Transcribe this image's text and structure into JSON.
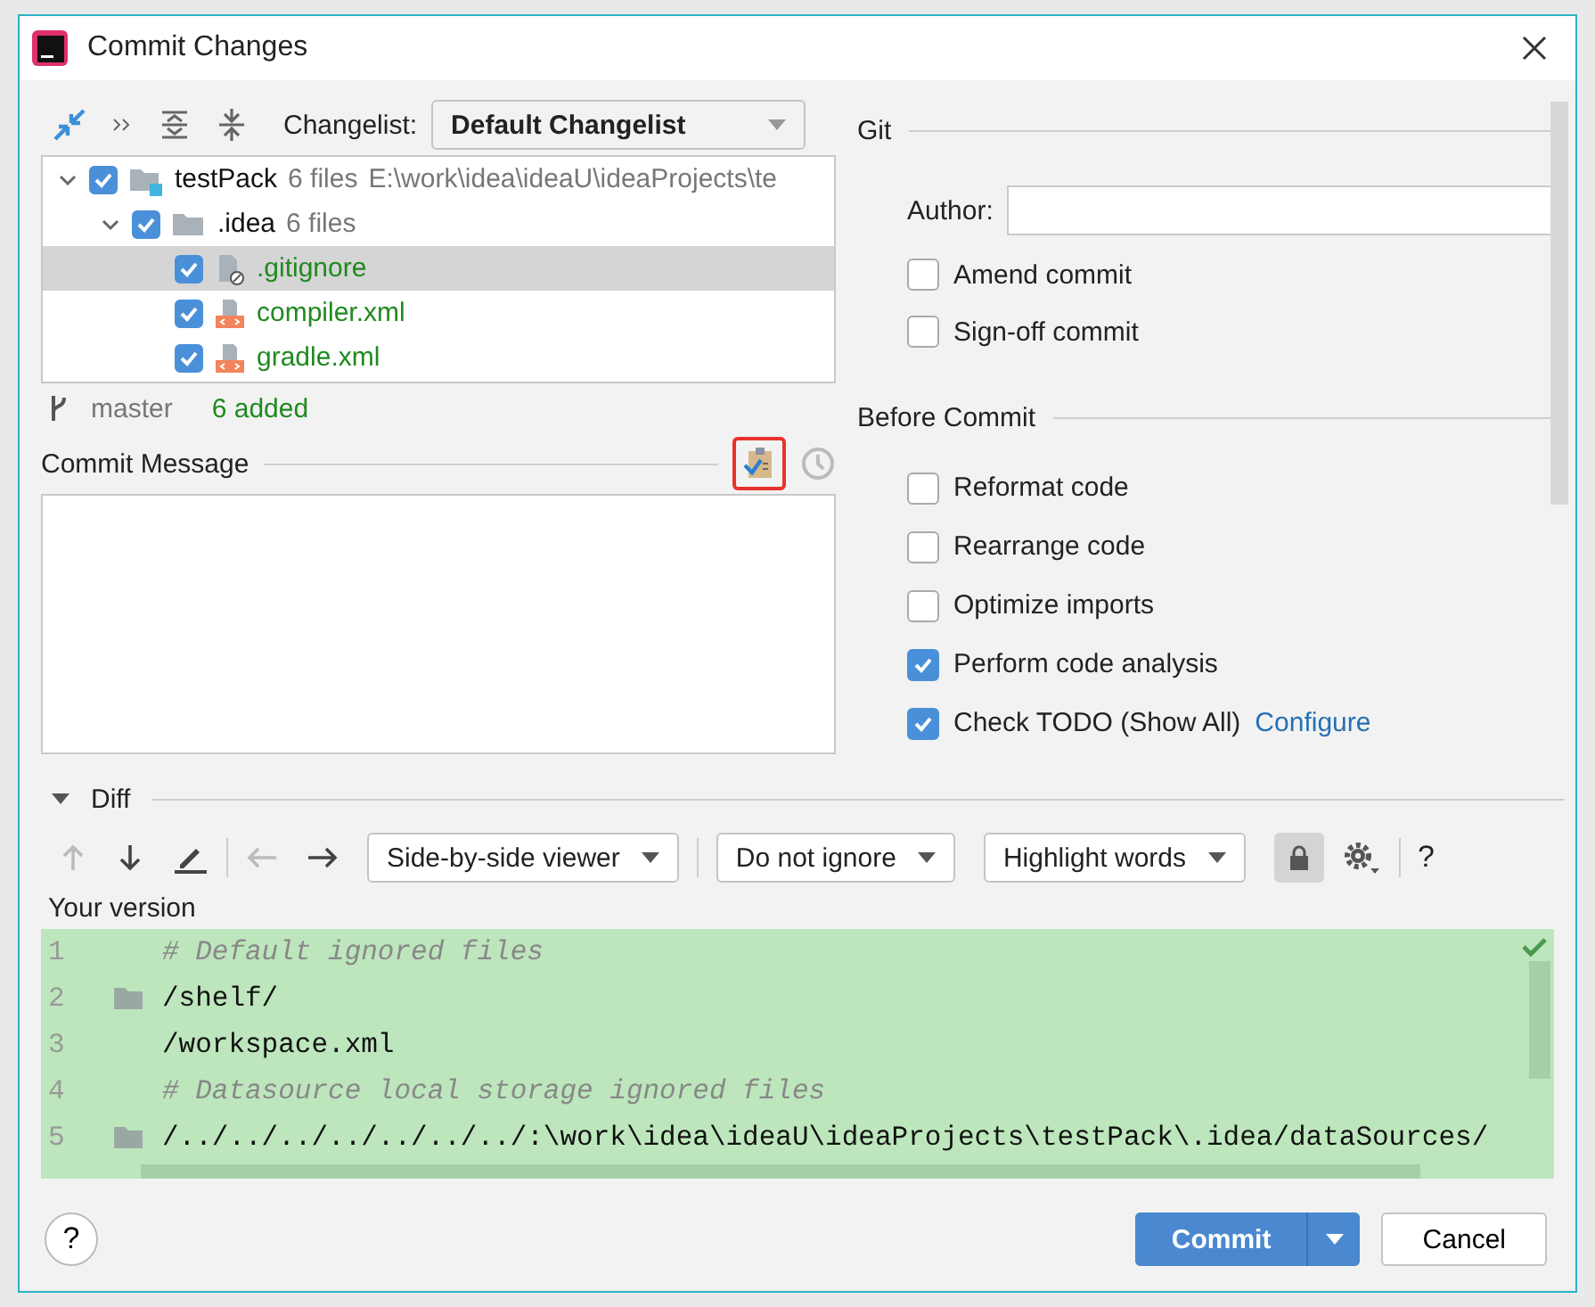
{
  "window": {
    "title": "Commit Changes"
  },
  "toolbar": {
    "changelist_label": "Changelist:",
    "changelist_value": "Default Changelist"
  },
  "tree": [
    {
      "name": "testPack",
      "count": "6 files",
      "path": "E:\\work\\idea\\ideaU\\ideaProjects\\te",
      "checked": true,
      "expanded": true,
      "selected": false,
      "kind": "module",
      "children": [
        {
          "name": ".idea",
          "count": "6 files",
          "checked": true,
          "expanded": true,
          "selected": false,
          "kind": "folder",
          "children": [
            {
              "name": ".gitignore",
              "checked": true,
              "selected": true,
              "kind": "ignore"
            },
            {
              "name": "compiler.xml",
              "checked": true,
              "selected": false,
              "kind": "xml"
            },
            {
              "name": "gradle.xml",
              "checked": true,
              "selected": false,
              "kind": "xml"
            }
          ]
        }
      ]
    }
  ],
  "status": {
    "branch": "master",
    "summary": "6 added"
  },
  "commit_message": {
    "label": "Commit Message"
  },
  "git": {
    "title": "Git",
    "author_label": "Author:",
    "options": [
      {
        "label": "Amend commit",
        "checked": false
      },
      {
        "label": "Sign-off commit",
        "checked": false
      }
    ]
  },
  "before_commit": {
    "title": "Before Commit",
    "options": [
      {
        "label": "Reformat code",
        "checked": false
      },
      {
        "label": "Rearrange code",
        "checked": false
      },
      {
        "label": "Optimize imports",
        "checked": false
      },
      {
        "label": "Perform code analysis",
        "checked": true
      },
      {
        "label": "Check TODO (Show All)",
        "checked": true,
        "link": "Configure"
      }
    ]
  },
  "diff": {
    "title": "Diff",
    "expanded": true,
    "viewer": "Side-by-side viewer",
    "ignore": "Do not ignore",
    "highlight": "Highlight words",
    "help": "?",
    "version_label": "Your version",
    "lines": [
      {
        "number": "1",
        "text": "# Default ignored files",
        "kind": "comment",
        "gutter_icon": false
      },
      {
        "number": "2",
        "text": "/shelf/",
        "kind": "code",
        "gutter_icon": true
      },
      {
        "number": "3",
        "text": "/workspace.xml",
        "kind": "code",
        "gutter_icon": false
      },
      {
        "number": "4",
        "text": "# Datasource local storage ignored files",
        "kind": "comment",
        "gutter_icon": false
      },
      {
        "number": "5",
        "text": "/../../../../../../../:\\work\\idea\\ideaU\\ideaProjects\\testPack\\.idea/dataSources/",
        "kind": "code",
        "gutter_icon": true
      }
    ]
  },
  "footer": {
    "help": "?",
    "commit": "Commit",
    "cancel": "Cancel"
  }
}
